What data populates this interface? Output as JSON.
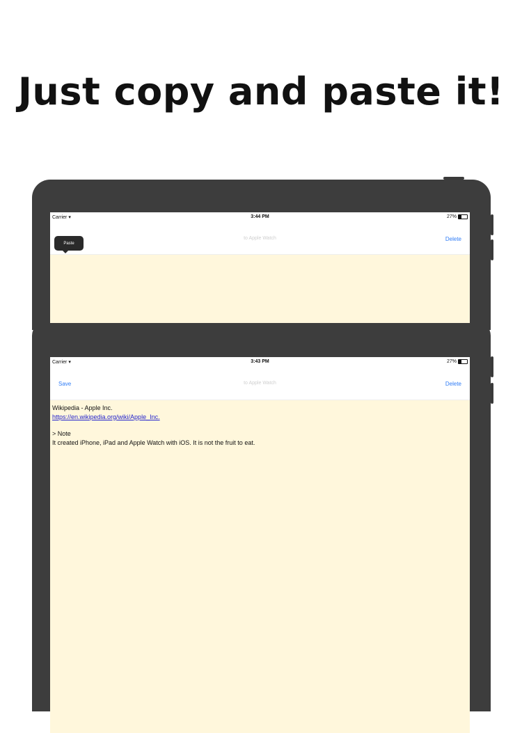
{
  "headline": "Just copy and paste it!",
  "top_screen": {
    "status": {
      "carrier": "Carrier",
      "time": "3:44 PM",
      "battery": "27%"
    },
    "paste_label": "Paste",
    "title": "to Apple Watch",
    "delete_label": "Delete"
  },
  "bottom_screen": {
    "status": {
      "carrier": "Carrier",
      "time": "3:43 PM",
      "battery": "27%"
    },
    "save_label": "Save",
    "title": "to Apple Watch",
    "delete_label": "Delete",
    "note": {
      "line1": "Wikipedia - Apple Inc.",
      "link": "https://en.wikipedia.org/wiki/Apple_Inc.",
      "line3": "> Note",
      "line4": "It created iPhone, iPad and Apple Watch with iOS. It is not the fruit to eat."
    }
  }
}
